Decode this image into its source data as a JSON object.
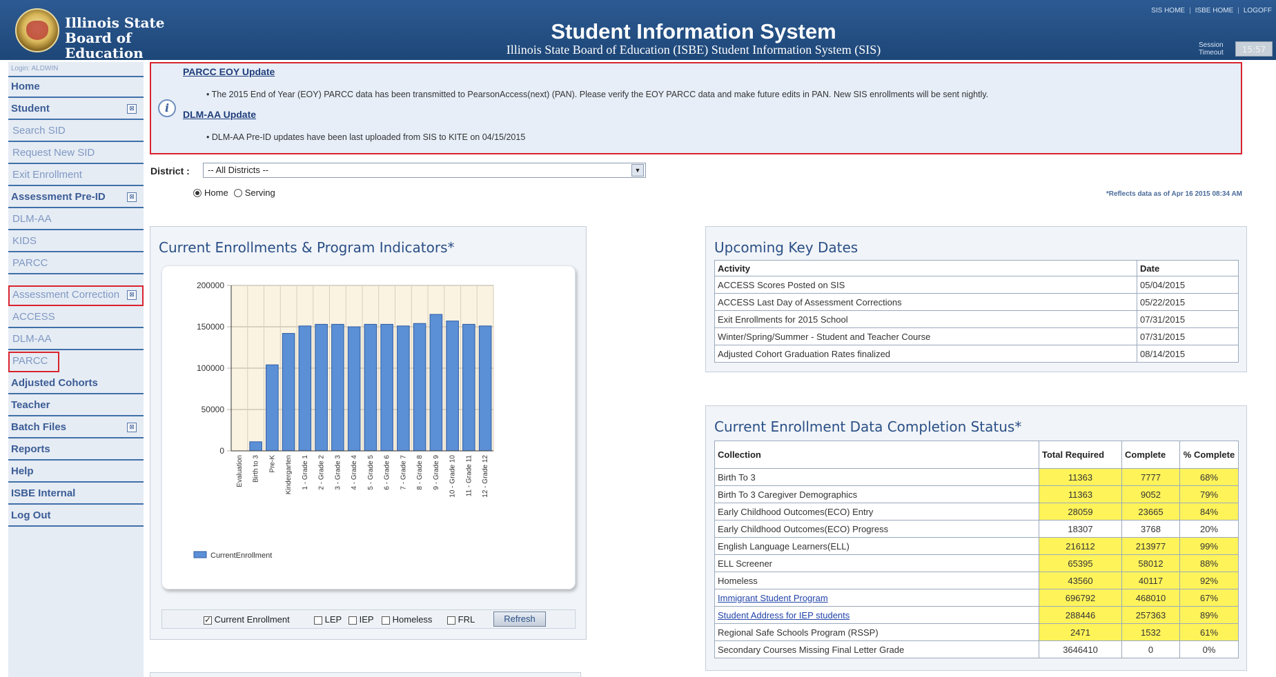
{
  "header": {
    "org_name": "Illinois State Board of Education",
    "title": "Student Information System",
    "subtitle": "Illinois State Board of Education (ISBE) Student Information System (SIS)",
    "top_links": [
      "SIS HOME",
      "ISBE HOME",
      "LOGOFF"
    ],
    "session_label": "Session Timeout",
    "session_value": "15:57"
  },
  "sidebar": {
    "login": "Login: ALDWIN",
    "items": [
      {
        "label": "Home"
      },
      {
        "label": "Student"
      },
      {
        "label": "Search SID"
      },
      {
        "label": "Request New SID"
      },
      {
        "label": "Exit Enrollment"
      },
      {
        "label": "Assessment Pre-ID"
      },
      {
        "label": "DLM-AA"
      },
      {
        "label": "KIDS"
      },
      {
        "label": "PARCC"
      },
      {
        "label": "Assessment Correction"
      },
      {
        "label": "ACCESS"
      },
      {
        "label": "DLM-AA"
      },
      {
        "label": "PARCC"
      },
      {
        "label": "Adjusted Cohorts"
      },
      {
        "label": "Teacher"
      },
      {
        "label": "Batch Files"
      },
      {
        "label": "Reports"
      },
      {
        "label": "Help"
      },
      {
        "label": "ISBE Internal"
      },
      {
        "label": "Log Out"
      }
    ],
    "expand_glyph": "⊠"
  },
  "alerts": {
    "items": [
      {
        "title": "PARCC EOY Update",
        "text": "•  The 2015 End of Year (EOY) PARCC data has been transmitted to PearsonAccess(next) (PAN). Please verify the EOY PARCC data and make future edits in PAN. New SIS enrollments will be sent nightly."
      },
      {
        "title": "DLM-AA Update",
        "text": "•  DLM-AA Pre-ID updates have been last uploaded from SIS to KITE on 04/15/2015"
      }
    ],
    "info_glyph": "i"
  },
  "filters": {
    "district_label": "District :",
    "district_value": "-- All Districts --",
    "dropdown_arrow": "▼",
    "radio_home": "Home",
    "radio_serving": "Serving",
    "as_of": "*Reflects data as of Apr 16 2015 08:34 AM"
  },
  "enrollment_panel": {
    "title": "Current Enrollments & Program Indicators*",
    "legend": "CurrentEnrollment",
    "controls": {
      "current_enrollment": "Current Enrollment",
      "lep": "LEP",
      "iep": "IEP",
      "homeless": "Homeless",
      "frl": "FRL",
      "refresh": "Refresh"
    }
  },
  "chart_data": {
    "type": "bar",
    "categories": [
      "Evaluation",
      "Birth to 3",
      "Pre-K",
      "Kindergarten",
      "1 - Grade 1",
      "2 - Grade 2",
      "3 - Grade 3",
      "4 - Grade 4",
      "5 - Grade 5",
      "6 - Grade 6",
      "7 - Grade 7",
      "8 - Grade 8",
      "9 - Grade 9",
      "10 - Grade 10",
      "11 - Grade 11",
      "12 - Grade 12"
    ],
    "series": [
      {
        "name": "CurrentEnrollment",
        "values": [
          0,
          11000,
          104000,
          142000,
          151000,
          153000,
          153000,
          150000,
          153000,
          153000,
          151000,
          154000,
          165000,
          157000,
          153000,
          151000
        ]
      }
    ],
    "ylim": [
      0,
      200000
    ],
    "yticks": [
      0,
      50000,
      100000,
      150000,
      200000
    ],
    "grid": true,
    "legend_position": "bottom-left",
    "bar_color": "#5b8fd6"
  },
  "key_dates": {
    "title": "Upcoming Key Dates",
    "columns": [
      "Activity",
      "Date"
    ],
    "rows": [
      [
        "ACCESS Scores Posted on SIS",
        "05/04/2015"
      ],
      [
        "ACCESS Last Day of Assessment Corrections",
        "05/22/2015"
      ],
      [
        "Exit Enrollments for 2015 School",
        "07/31/2015"
      ],
      [
        "Winter/Spring/Summer - Student and Teacher Course",
        "07/31/2015"
      ],
      [
        "Adjusted Cohort Graduation Rates finalized",
        "08/14/2015"
      ]
    ]
  },
  "completion": {
    "title": "Current Enrollment Data Completion Status*",
    "columns": [
      "Collection",
      "Total Required",
      "Complete",
      "% Complete"
    ],
    "rows": [
      {
        "collection": "Birth To 3",
        "total": "11363",
        "complete": "7777",
        "pct": "68%",
        "link": false,
        "hl": true
      },
      {
        "collection": "Birth To 3 Caregiver Demographics",
        "total": "11363",
        "complete": "9052",
        "pct": "79%",
        "link": false,
        "hl": true
      },
      {
        "collection": "Early Childhood Outcomes(ECO) Entry",
        "total": "28059",
        "complete": "23665",
        "pct": "84%",
        "link": false,
        "hl": true
      },
      {
        "collection": "Early Childhood Outcomes(ECO) Progress",
        "total": "18307",
        "complete": "3768",
        "pct": "20%",
        "link": false,
        "hl": false
      },
      {
        "collection": "English Language Learners(ELL)",
        "total": "216112",
        "complete": "213977",
        "pct": "99%",
        "link": false,
        "hl": true
      },
      {
        "collection": "ELL Screener",
        "total": "65395",
        "complete": "58012",
        "pct": "88%",
        "link": false,
        "hl": true
      },
      {
        "collection": "Homeless",
        "total": "43560",
        "complete": "40117",
        "pct": "92%",
        "link": false,
        "hl": true
      },
      {
        "collection": "Immigrant Student Program",
        "total": "696792",
        "complete": "468010",
        "pct": "67%",
        "link": true,
        "hl": true
      },
      {
        "collection": "Student Address for IEP students",
        "total": "288446",
        "complete": "257363",
        "pct": "89%",
        "link": true,
        "hl": true
      },
      {
        "collection": "Regional Safe Schools Program (RSSP)",
        "total": "2471",
        "complete": "1532",
        "pct": "61%",
        "link": false,
        "hl": true
      },
      {
        "collection": "Secondary Courses Missing Final Letter Grade",
        "total": "3646410",
        "complete": "0",
        "pct": "0%",
        "link": false,
        "hl": false
      }
    ]
  }
}
